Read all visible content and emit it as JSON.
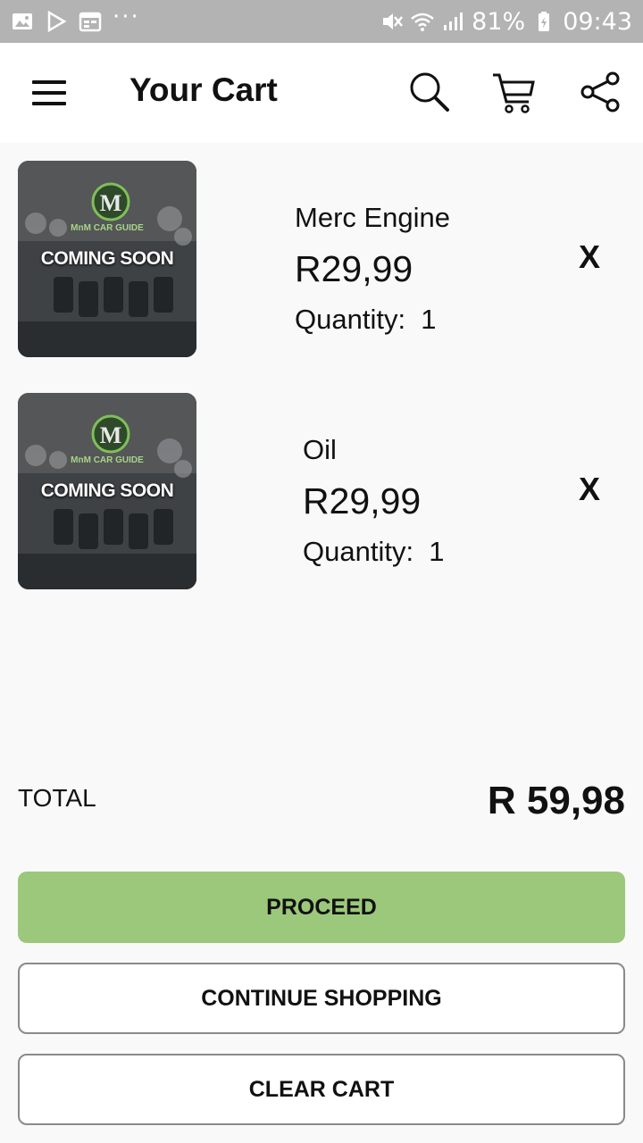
{
  "status_bar": {
    "battery": "81%",
    "time": "09:43",
    "dots": "···",
    "icons": [
      "image-icon",
      "play-store-icon",
      "calendar-icon",
      "mute-icon",
      "wifi-icon",
      "signal-icon",
      "battery-charging-icon"
    ]
  },
  "app_bar": {
    "title": "Your Cart",
    "icons": [
      "menu-icon",
      "search-icon",
      "cart-icon",
      "share-icon"
    ]
  },
  "cart": {
    "items": [
      {
        "name": "Merc Engine",
        "price": "R29,99",
        "quantity_label": "Quantity:  1",
        "image_overlay": "COMING SOON",
        "image_logo": "MnM CAR GUIDE",
        "remove": "X"
      },
      {
        "name": "Oil",
        "price": "R29,99",
        "quantity_label": "Quantity:  1",
        "image_overlay": "COMING SOON",
        "image_logo": "MnM CAR GUIDE",
        "remove": "X"
      }
    ]
  },
  "total": {
    "label": "TOTAL",
    "value": "R 59,98"
  },
  "buttons": {
    "proceed": "PROCEED",
    "continue": "CONTINUE SHOPPING",
    "clear": "CLEAR CART"
  },
  "colors": {
    "status_bar": "#b3b3b3",
    "proceed_button": "#9bc87a",
    "background": "#f9f9f9"
  }
}
